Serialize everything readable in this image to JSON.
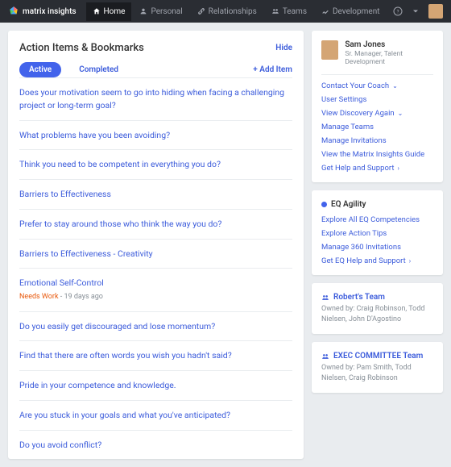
{
  "brand": "matrix insights",
  "nav": [
    {
      "label": "Home",
      "active": true
    },
    {
      "label": "Personal",
      "active": false
    },
    {
      "label": "Relationships",
      "active": false
    },
    {
      "label": "Teams",
      "active": false
    },
    {
      "label": "Development",
      "active": false
    }
  ],
  "main": {
    "title": "Action Items & Bookmarks",
    "hide": "Hide",
    "tabs": {
      "active": "Active",
      "completed": "Completed"
    },
    "add": "+ Add Item",
    "items": [
      {
        "text": "Does your motivation seem to go into hiding when facing a challenging project or long-term goal?"
      },
      {
        "text": "What problems have you been avoiding?"
      },
      {
        "text": "Think you need to be competent in everything you do?"
      },
      {
        "text": "Barriers to Effectiveness"
      },
      {
        "text": "Prefer to stay around those who think the way you do?"
      },
      {
        "text": "Barriers to Effectiveness - Creativity"
      },
      {
        "text": "Emotional Self-Control",
        "status": "Needs Work",
        "time": "19 days ago"
      },
      {
        "text": "Do you easily get discouraged and lose momentum?"
      },
      {
        "text": "Find that there are often words you wish you hadn't said?"
      },
      {
        "text": "Pride in your competence and knowledge."
      },
      {
        "text": "Are you stuck in your goals and what you've anticipated?"
      },
      {
        "text": "Do you avoid conflict?"
      }
    ]
  },
  "user": {
    "name": "Sam Jones",
    "role": "Sr. Manager, Talent Development"
  },
  "userLinks": [
    {
      "label": "Contact Your Coach",
      "chev": "v"
    },
    {
      "label": "User Settings"
    },
    {
      "label": "View Discovery Again",
      "chev": "v"
    },
    {
      "label": "Manage Teams"
    },
    {
      "label": "Manage Invitations"
    },
    {
      "label": "View the Matrix Insights Guide"
    },
    {
      "label": "Get Help and Support",
      "chev": "›"
    }
  ],
  "eq": {
    "title": "EQ Agility",
    "links": [
      {
        "label": "Explore All EQ Competencies"
      },
      {
        "label": "Explore Action Tips"
      },
      {
        "label": "Manage 360 Invitations"
      },
      {
        "label": "Get EQ Help and Support",
        "chev": "›"
      }
    ]
  },
  "teams": [
    {
      "name": "Robert's Team",
      "owners": "Owned by: Craig Robinson, Todd Nielsen, John D'Agostino"
    },
    {
      "name": "EXEC COMMITTEE Team",
      "owners": "Owned by: Pam Smith, Todd Nielsen, Craig Robinson"
    }
  ]
}
